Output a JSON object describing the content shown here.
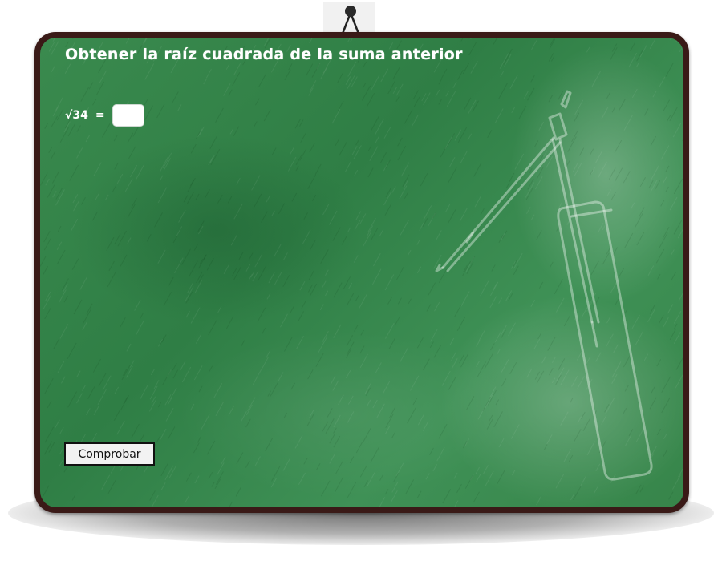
{
  "activity": {
    "title": "Obtener la raíz cuadrada de la suma anterior",
    "equation": {
      "expression": "√34",
      "equals_sign": "=",
      "answer_value": "",
      "answer_placeholder": ""
    },
    "check_button_label": "Comprobar"
  },
  "colors": {
    "board_green": "#35864b",
    "frame_brown": "#3a1a17",
    "chalk_white": "#ffffff"
  },
  "decorations": {
    "hanger": "nail-hanger-icon",
    "chalk_drawing": "ruler-and-compass-icon"
  }
}
